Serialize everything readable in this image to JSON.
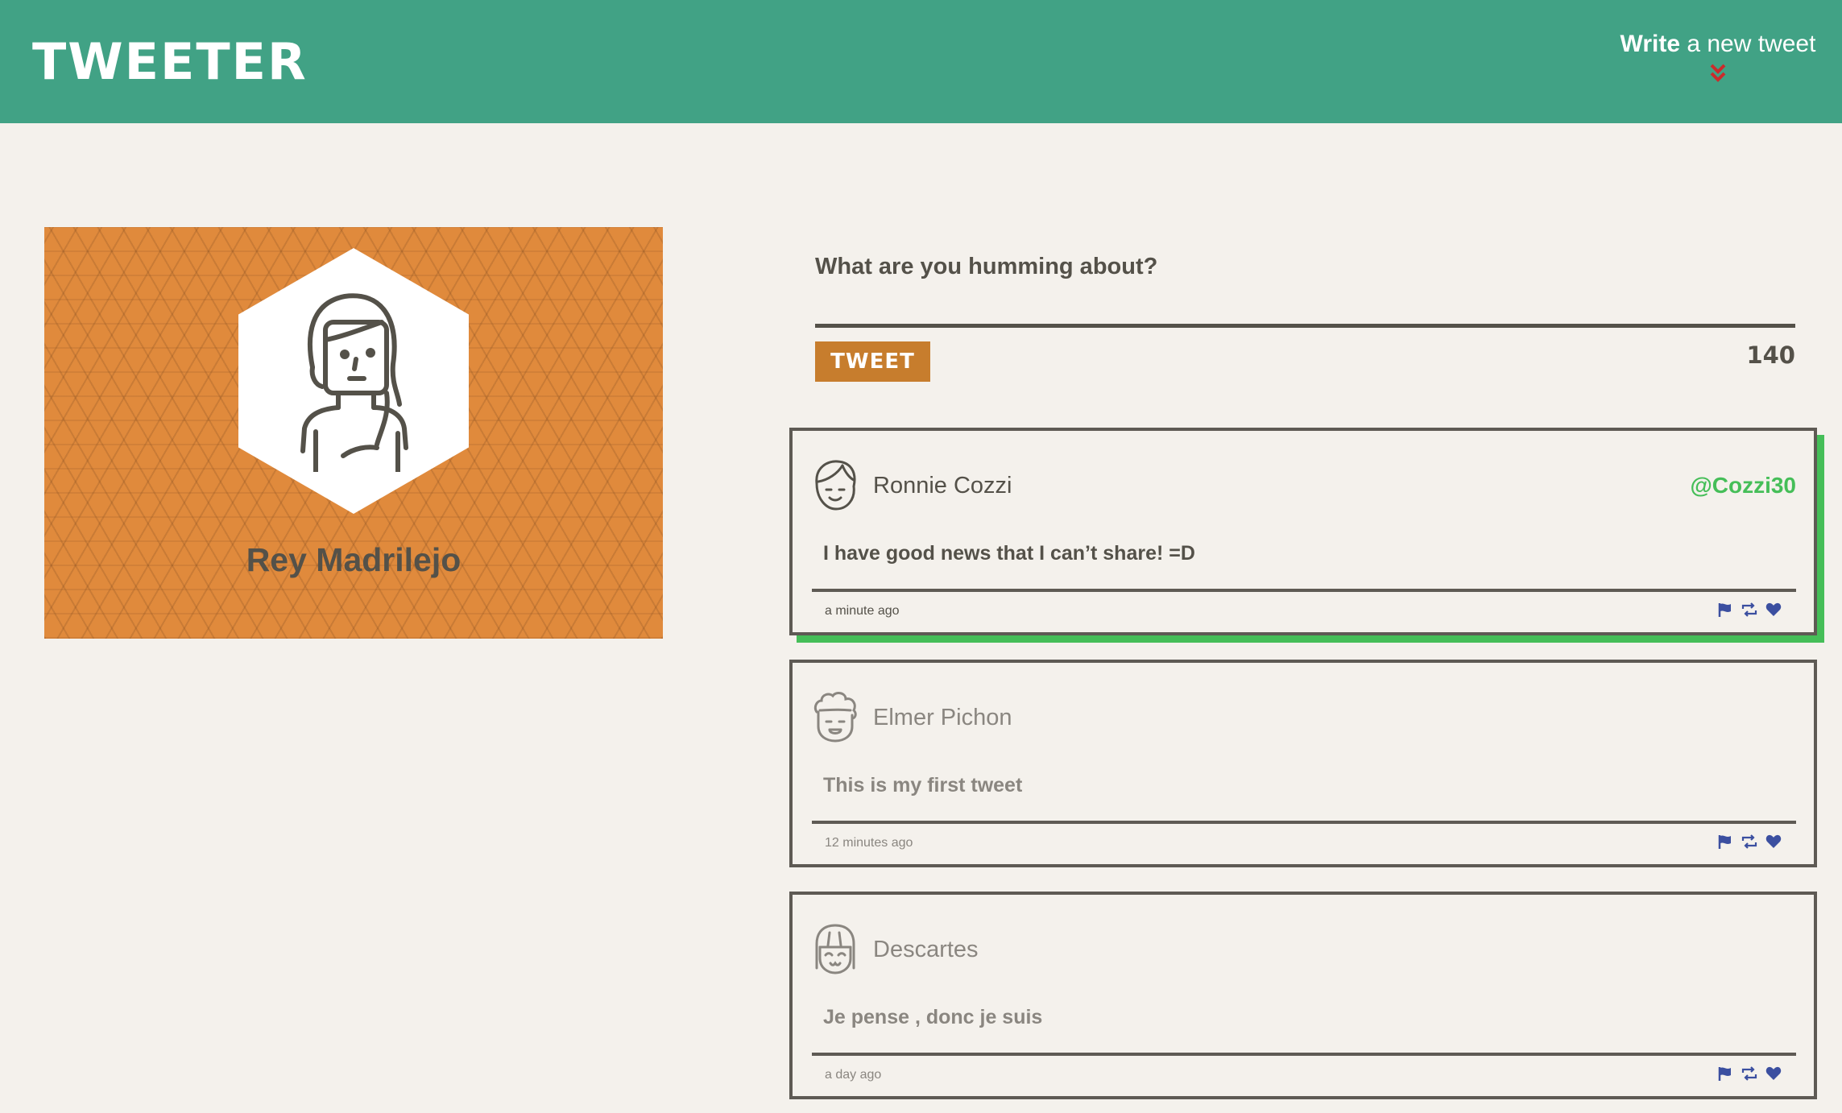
{
  "nav": {
    "brand": "TWEETER",
    "compose_strong": "Write",
    "compose_rest": " a new tweet",
    "arrow_icon": "double-chevron-down-icon",
    "arrow_color": "#cc2b2b"
  },
  "profile": {
    "name": "Rey Madrilejo",
    "avatar_icon": "person-long-hair-icon",
    "banner_color": "#e08a3c"
  },
  "compose": {
    "prompt": "What are you humming about?",
    "textarea_value": "",
    "tweet_button": "TWEET",
    "counter": "140"
  },
  "tweets": [
    {
      "name": "Ronnie Cozzi",
      "handle": "@Cozzi30",
      "text": "I have good news that I can’t share! =D",
      "time": "a minute ago",
      "avatar_icon": "smiling-boy-face-icon"
    },
    {
      "name": "Elmer Pichon",
      "handle": "",
      "text": "This is my first tweet",
      "time": "12 minutes ago",
      "avatar_icon": "curly-hair-face-icon"
    },
    {
      "name": "Descartes",
      "handle": "",
      "text": "Je pense , donc je suis",
      "time": "a day ago",
      "avatar_icon": "bangs-hair-face-icon"
    }
  ],
  "actions": [
    "flag-icon",
    "retweet-icon",
    "heart-icon"
  ],
  "colors": {
    "header": "#41a285",
    "background": "#f4f1ec",
    "accent_green": "#45be58",
    "button_orange": "#c77d2d",
    "action_blue": "#3b4fa0",
    "text": "#545149"
  }
}
